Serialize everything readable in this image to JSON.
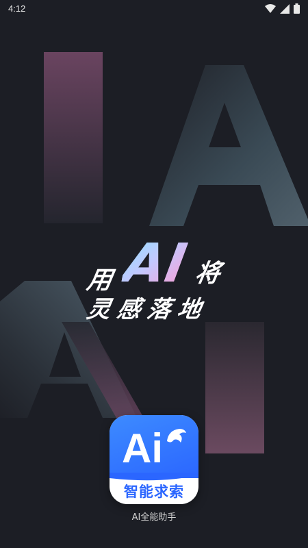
{
  "status_bar": {
    "time": "4:12",
    "icons": [
      "wifi-icon",
      "signal-icon",
      "battery-icon"
    ]
  },
  "slogan": {
    "word_use": "用",
    "word_ai": "AI",
    "word_will": "将",
    "line2": "灵感落地"
  },
  "app_icon": {
    "big_text": "Ai",
    "label": "智能求索"
  },
  "app_name": "AI全能助手",
  "colors": {
    "background": "#1c1e25",
    "brand_blue": "#2b66ff",
    "accent_pink": "#ff9bd2",
    "accent_cyan": "#8de3ff"
  }
}
